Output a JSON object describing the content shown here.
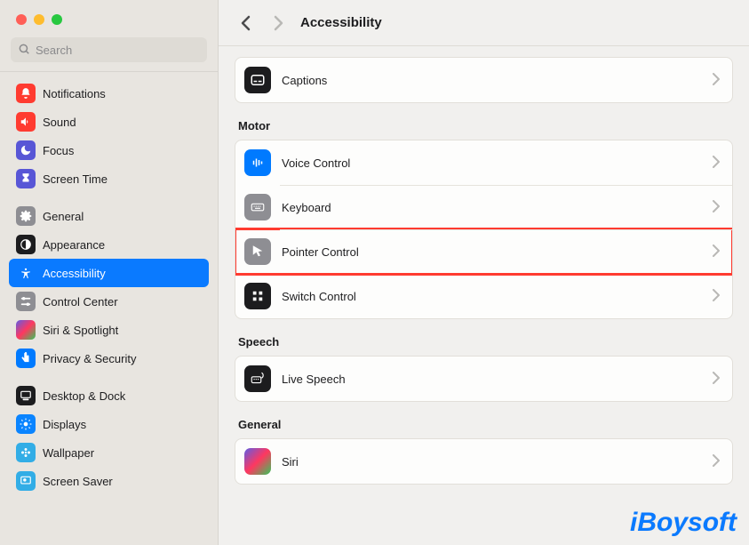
{
  "window": {
    "title": "Accessibility"
  },
  "search": {
    "placeholder": "Search",
    "value": ""
  },
  "sidebar": {
    "groups": [
      {
        "items": [
          {
            "id": "notifications",
            "label": "Notifications"
          },
          {
            "id": "sound",
            "label": "Sound"
          },
          {
            "id": "focus",
            "label": "Focus"
          },
          {
            "id": "screentime",
            "label": "Screen Time"
          }
        ]
      },
      {
        "items": [
          {
            "id": "general",
            "label": "General"
          },
          {
            "id": "appearance",
            "label": "Appearance"
          },
          {
            "id": "accessibility",
            "label": "Accessibility",
            "selected": true
          },
          {
            "id": "controlcenter",
            "label": "Control Center"
          },
          {
            "id": "siri",
            "label": "Siri & Spotlight"
          },
          {
            "id": "privacy",
            "label": "Privacy & Security"
          }
        ]
      },
      {
        "items": [
          {
            "id": "desktop",
            "label": "Desktop & Dock"
          },
          {
            "id": "displays",
            "label": "Displays"
          },
          {
            "id": "wallpaper",
            "label": "Wallpaper"
          },
          {
            "id": "screensaver",
            "label": "Screen Saver"
          }
        ]
      }
    ]
  },
  "panel": {
    "sections": [
      {
        "title": "",
        "rows": [
          {
            "id": "captions",
            "label": "Captions",
            "icon": "captions"
          }
        ]
      },
      {
        "title": "Motor",
        "rows": [
          {
            "id": "voicecontrol",
            "label": "Voice Control",
            "icon": "voicecontrol"
          },
          {
            "id": "keyboard",
            "label": "Keyboard",
            "icon": "keyboard"
          },
          {
            "id": "pointer",
            "label": "Pointer Control",
            "icon": "pointer",
            "highlighted": true
          },
          {
            "id": "switch",
            "label": "Switch Control",
            "icon": "switch"
          }
        ]
      },
      {
        "title": "Speech",
        "rows": [
          {
            "id": "livespeech",
            "label": "Live Speech",
            "icon": "livespeech"
          }
        ]
      },
      {
        "title": "General",
        "rows": [
          {
            "id": "siri",
            "label": "Siri",
            "icon": "siri"
          }
        ]
      }
    ]
  },
  "watermark": "iBoysoft"
}
